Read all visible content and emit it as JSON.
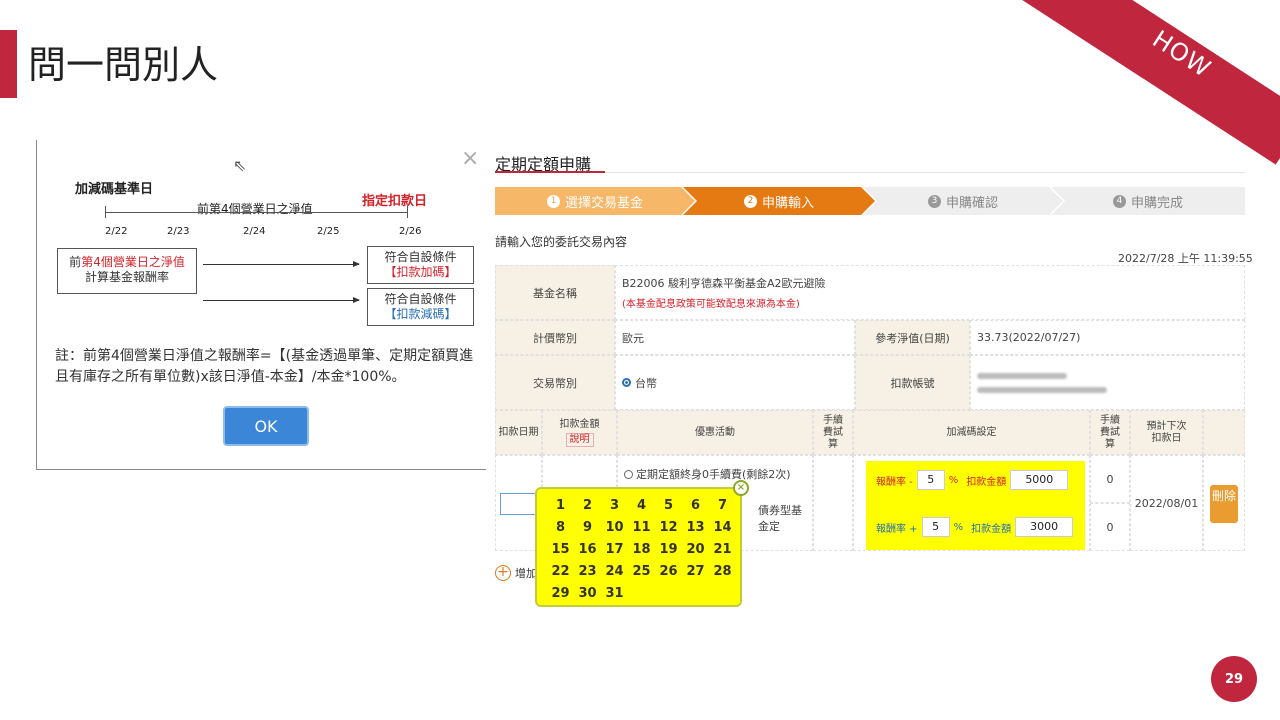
{
  "slide": {
    "title": "問一問別人",
    "corner": "HOW",
    "page": "29"
  },
  "dialog": {
    "base_date_label": "加減碼基準日",
    "nav_label": "前第4個營業日之淨值",
    "designated_label": "指定扣款日",
    "dates": [
      "2/22",
      "2/23",
      "2/24",
      "2/25",
      "2/26"
    ],
    "left_box": {
      "prefix": "前",
      "highlight": "第4個營業日之淨值",
      "line2": "計算基金報酬率"
    },
    "right_box_1": {
      "line1": "符合自設條件",
      "line2": "【扣款加碼】"
    },
    "right_box_2": {
      "line1": "符合自設條件",
      "line2": "【扣款減碼】"
    },
    "note": "註：前第4個營業日淨值之報酬率=【(基金透過單筆、定期定額買進且有庫存之所有單位數)x該日淨值-本金】/本金*100%。",
    "ok_label": "OK",
    "close_icon": "×",
    "cursor_icon": "⇖"
  },
  "form": {
    "title": "定期定額申購",
    "steps": [
      {
        "num": "1",
        "label": "選擇交易基金"
      },
      {
        "num": "2",
        "label": "申購輸入"
      },
      {
        "num": "3",
        "label": "申購確認"
      },
      {
        "num": "4",
        "label": "申購完成"
      }
    ],
    "prompt": "請輸入您的委託交易內容",
    "timestamp": "2022/7/28 上午 11:39:55",
    "fund_name_label": "基金名稱",
    "fund_name": "B22006 駿利亨德森平衡基金A2歐元避險",
    "fund_note": "(本基金配息政策可能致配息來源為本金)",
    "currency_label": "計價幣別",
    "currency": "歐元",
    "ref_nav_label": "參考淨值(日期)",
    "ref_nav": "33.73(2022/07/27)",
    "trade_currency_label": "交易幣別",
    "trade_currency": "台幣",
    "debit_account_label": "扣款帳號",
    "headers": {
      "debit_date": "扣款日期",
      "debit_amount": "扣款金額",
      "explain": "說明",
      "promotion": "優惠活動",
      "fee_calc": "手續費試算",
      "adjust": "加減碼設定",
      "fee_calc2": "手續費試算",
      "next_debit": "預計下次扣款日"
    },
    "promo_1": "定期定額終身0手續費(剩餘2次)",
    "promo_2_tail": "債券型基金定",
    "adjust_rows": [
      {
        "rate_label": "報酬率 -",
        "rate": "5",
        "pct": "%",
        "amount_label": "扣款金額",
        "amount": "5000",
        "fee": "0"
      },
      {
        "rate_label": "報酬率 +",
        "rate": "5",
        "pct": "%",
        "amount_label": "扣款金額",
        "amount": "3000",
        "fee": "0"
      }
    ],
    "next_date": "2022/08/01",
    "delete_label": "刪除",
    "add_label": "增加",
    "plus_icon": "+"
  },
  "calendar": {
    "days": [
      "1",
      "2",
      "3",
      "4",
      "5",
      "6",
      "7",
      "8",
      "9",
      "10",
      "11",
      "12",
      "13",
      "14",
      "15",
      "16",
      "17",
      "18",
      "19",
      "20",
      "21",
      "22",
      "23",
      "24",
      "25",
      "26",
      "27",
      "28",
      "29",
      "30",
      "31"
    ],
    "close_icon": "×"
  },
  "colors": {
    "brand_red": "#c0263d",
    "step_active": "#e57a12",
    "step_done": "#f6b768",
    "highlight_yellow": "#ffff00",
    "ok_blue": "#3b86d6"
  }
}
